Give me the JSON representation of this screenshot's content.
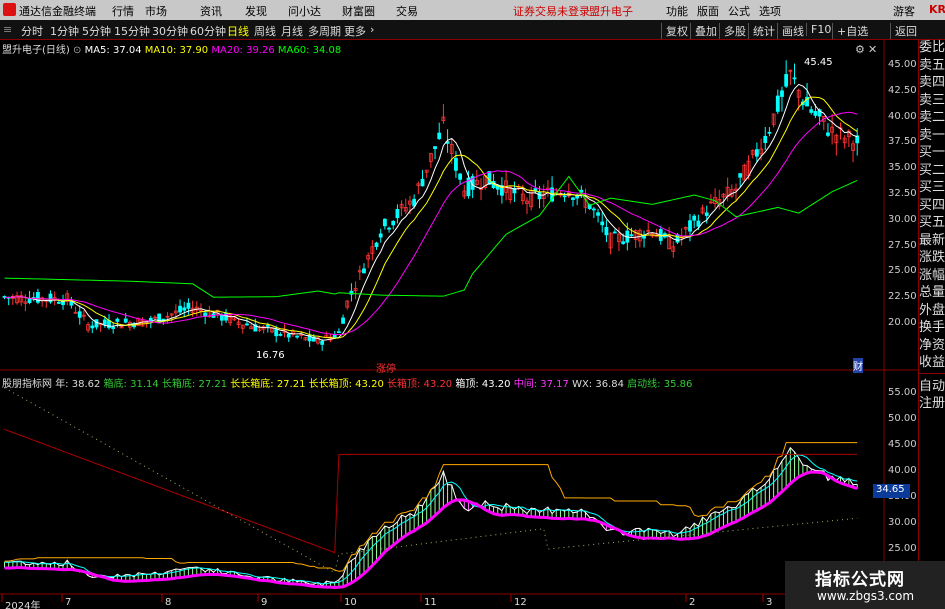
{
  "menubar": {
    "app_title": "通达信金融终端",
    "items": [
      "行情",
      "市场",
      "资讯",
      "发现",
      "问小达",
      "财富圈",
      "交易"
    ],
    "login_status": "证券交易未登录",
    "stock_name": "盟升电子",
    "right_items": [
      "功能",
      "版面",
      "公式",
      "选项"
    ],
    "guest": "游客",
    "kr": "KR"
  },
  "toolbar": {
    "periods": [
      "分时",
      "1分钟",
      "5分钟",
      "15分钟",
      "30分钟",
      "60分钟",
      "日线",
      "周线",
      "月线",
      "多周期",
      "更多"
    ],
    "active": "日线",
    "right": [
      "复权",
      "叠加",
      "多股",
      "统计",
      "画线",
      "F10",
      "+自选",
      "返回"
    ]
  },
  "main_chart": {
    "name": "盟升电子(日线)",
    "ma5": "MA5: 37.04",
    "ma10": "MA10: 37.90",
    "ma20": "MA20: 39.26",
    "ma60": "MA60: 34.08",
    "high_label": "45.45",
    "low_label": "16.76",
    "zt_label": "涨停",
    "cai": "财"
  },
  "indicator": {
    "name": "股朋指标网",
    "items": [
      {
        "t": "年: 38.62",
        "c": "#ddd"
      },
      {
        "t": "箱底: 31.14",
        "c": "#3c3"
      },
      {
        "t": "长箱底: 27.21",
        "c": "#3c3"
      },
      {
        "t": "长长箱底: 27.21",
        "c": "#ff0"
      },
      {
        "t": "长长箱顶: 43.20",
        "c": "#ff0"
      },
      {
        "t": "长箱顶: 43.20",
        "c": "#f33"
      },
      {
        "t": "箱顶: 43.20",
        "c": "#fff"
      },
      {
        "t": "中间: 37.17",
        "c": "#f3f"
      },
      {
        "t": "WX: 36.84",
        "c": "#ddd"
      },
      {
        "t": "启动线: 35.86",
        "c": "#3c3"
      }
    ],
    "last_price": "34.65"
  },
  "main_yaxis": [
    "45.00",
    "42.50",
    "40.00",
    "37.50",
    "35.00",
    "32.50",
    "30.00",
    "27.50",
    "25.00",
    "22.50",
    "20.00"
  ],
  "ind_yaxis": [
    "55.00",
    "50.00",
    "45.00",
    "40.00",
    "35.00",
    "30.00",
    "25.00"
  ],
  "xaxis": [
    "2024年",
    "7",
    "8",
    "9",
    "10",
    "11",
    "12",
    "2",
    "3"
  ],
  "side_tabs": [
    "委比",
    "卖五",
    "卖四",
    "卖三",
    "卖二",
    "卖一",
    "买一",
    "买二",
    "买三",
    "买四",
    "买五",
    "最新",
    "涨跌",
    "涨幅",
    "总量",
    "外盘",
    "换手",
    "净资",
    "收益"
  ],
  "side_tabs2": [
    "自动",
    "注册"
  ],
  "watermark": {
    "line1": "指标公式网",
    "line2": "www.zbgs3.com"
  },
  "colors": {
    "up": "#ff3232",
    "down": "#00ffff",
    "ma5": "#ffffff",
    "ma10": "#ffff00",
    "ma20": "#ff00ff",
    "ma60": "#00ff00"
  }
}
